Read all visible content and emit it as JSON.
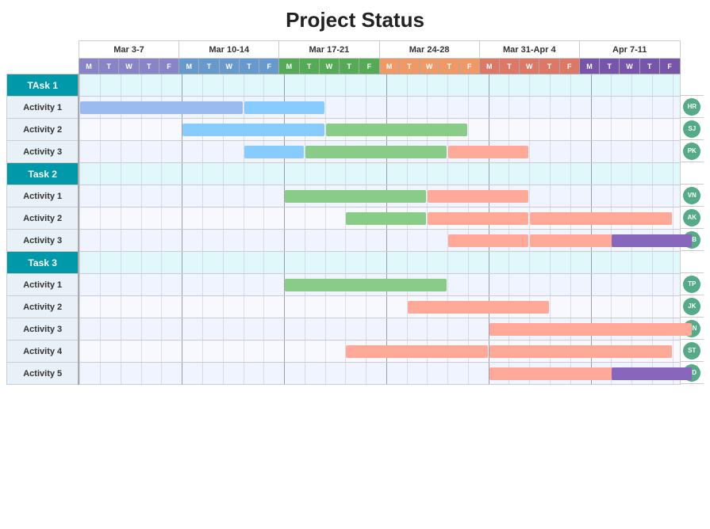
{
  "title": "Project Status",
  "weeks": [
    {
      "label": "Mar 3-7",
      "days": [
        "M",
        "T",
        "W",
        "T",
        "F"
      ],
      "class": "week1"
    },
    {
      "label": "Mar 10-14",
      "days": [
        "M",
        "T",
        "W",
        "T",
        "F"
      ],
      "class": "week2"
    },
    {
      "label": "Mar 17-21",
      "days": [
        "M",
        "T",
        "W",
        "T",
        "F"
      ],
      "class": "week3"
    },
    {
      "label": "Mar 24-28",
      "days": [
        "M",
        "T",
        "W",
        "T",
        "F"
      ],
      "class": "week4"
    },
    {
      "label": "Mar 31-Apr 4",
      "days": [
        "M",
        "T",
        "W",
        "T",
        "F"
      ],
      "class": "week5"
    },
    {
      "label": "Apr 7-11",
      "days": [
        "M",
        "T",
        "W",
        "T",
        "F"
      ],
      "class": "week6"
    }
  ],
  "rows": [
    {
      "type": "task",
      "label": "TAsk 1",
      "avatar": null,
      "bars": []
    },
    {
      "type": "activity",
      "label": "Activity 1",
      "avatar": "HR",
      "bars": [
        {
          "start": 1,
          "width": 8,
          "color": "bar-blue"
        },
        {
          "start": 9,
          "width": 4,
          "color": "bar-lblue"
        }
      ]
    },
    {
      "type": "activity",
      "label": "Activity 2",
      "avatar": "SJ",
      "bars": [
        {
          "start": 6,
          "width": 7,
          "color": "bar-lblue"
        },
        {
          "start": 13,
          "width": 7,
          "color": "bar-green"
        }
      ]
    },
    {
      "type": "activity",
      "label": "Activity 3",
      "avatar": "PK",
      "bars": [
        {
          "start": 9,
          "width": 3,
          "color": "bar-lblue"
        },
        {
          "start": 12,
          "width": 7,
          "color": "bar-green"
        },
        {
          "start": 19,
          "width": 4,
          "color": "bar-salmon"
        }
      ]
    },
    {
      "type": "task",
      "label": "Task 2",
      "avatar": null,
      "bars": []
    },
    {
      "type": "activity",
      "label": "Activity 1",
      "avatar": "VN",
      "bars": [
        {
          "start": 11,
          "width": 7,
          "color": "bar-green"
        },
        {
          "start": 18,
          "width": 5,
          "color": "bar-salmon"
        }
      ]
    },
    {
      "type": "activity",
      "label": "Activity 2",
      "avatar": "AK",
      "bars": [
        {
          "start": 14,
          "width": 4,
          "color": "bar-green"
        },
        {
          "start": 18,
          "width": 5,
          "color": "bar-salmon"
        },
        {
          "start": 23,
          "width": 7,
          "color": "bar-salmon"
        }
      ]
    },
    {
      "type": "activity",
      "label": "Activity 3",
      "avatar": "AB",
      "bars": [
        {
          "start": 19,
          "width": 4,
          "color": "bar-salmon"
        },
        {
          "start": 23,
          "width": 7,
          "color": "bar-salmon"
        },
        {
          "start": 27,
          "width": 4,
          "color": "bar-purple"
        }
      ]
    },
    {
      "type": "task",
      "label": "Task 3",
      "avatar": null,
      "bars": []
    },
    {
      "type": "activity",
      "label": "Activity 1",
      "avatar": "TP",
      "bars": [
        {
          "start": 11,
          "width": 8,
          "color": "bar-green"
        }
      ]
    },
    {
      "type": "activity",
      "label": "Activity 2",
      "avatar": "JK",
      "bars": [
        {
          "start": 17,
          "width": 7,
          "color": "bar-salmon"
        }
      ]
    },
    {
      "type": "activity",
      "label": "Activity 3",
      "avatar": "MN",
      "bars": [
        {
          "start": 21,
          "width": 10,
          "color": "bar-salmon"
        }
      ]
    },
    {
      "type": "activity",
      "label": "Activity 4",
      "avatar": "ST",
      "bars": [
        {
          "start": 14,
          "width": 7,
          "color": "bar-salmon"
        },
        {
          "start": 21,
          "width": 9,
          "color": "bar-salmon"
        }
      ]
    },
    {
      "type": "activity",
      "label": "Activity 5",
      "avatar": "DD",
      "bars": [
        {
          "start": 21,
          "width": 8,
          "color": "bar-salmon"
        },
        {
          "start": 27,
          "width": 4,
          "color": "bar-purple"
        }
      ]
    }
  ],
  "avatarColors": {
    "HR": "#55aa88",
    "SJ": "#55aa88",
    "PK": "#55aa88",
    "VN": "#55aa88",
    "AK": "#55aa88",
    "AB": "#55aa88",
    "TP": "#55aa88",
    "JK": "#55aa88",
    "MN": "#55aa88",
    "ST": "#55aa88",
    "DD": "#55aa88"
  }
}
